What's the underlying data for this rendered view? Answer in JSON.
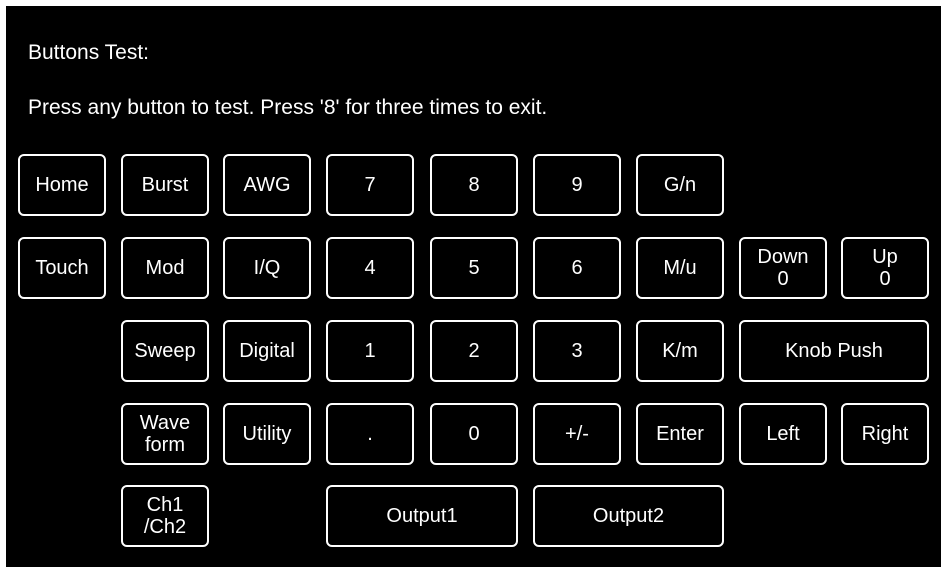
{
  "header": {
    "title": "Buttons Test:",
    "instruction": "Press any button to test. Press '8' for three times to exit."
  },
  "keys": {
    "home": "Home",
    "burst": "Burst",
    "awg": "AWG",
    "seven": "7",
    "eight": "8",
    "nine": "9",
    "g_n": "G/n",
    "touch": "Touch",
    "mod": "Mod",
    "iq": "I/Q",
    "four": "4",
    "five": "5",
    "six": "6",
    "m_u": "M/u",
    "down": {
      "label": "Down",
      "count": "0"
    },
    "up": {
      "label": "Up",
      "count": "0"
    },
    "sweep": "Sweep",
    "digital": "Digital",
    "one": "1",
    "two": "2",
    "three": "3",
    "k_m": "K/m",
    "knob_push": "Knob Push",
    "waveform": {
      "line1": "Wave",
      "line2": "form"
    },
    "utility": "Utility",
    "dot": ".",
    "zero": "0",
    "plus_minus": "+/-",
    "enter": "Enter",
    "left": "Left",
    "right": "Right",
    "ch1_ch2": {
      "line1": "Ch1",
      "line2": "/Ch2"
    },
    "output1": "Output1",
    "output2": "Output2"
  }
}
